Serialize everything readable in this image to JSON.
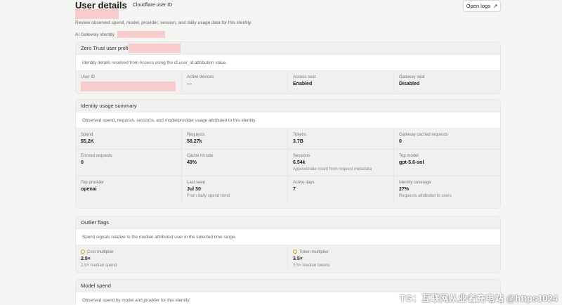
{
  "header": {
    "title": "User details",
    "uid_tag": "Cloudflare user ID",
    "open_logs": "Open logs",
    "open_logs_icon": "↗",
    "description": "Review observed spend, model, provider, session, and daily usage data for this identity.",
    "gateway_label": "AI Gateway identity"
  },
  "zero_trust": {
    "title": "Zero Trust user profi",
    "note": "Identity details resolved from Access using the cf.user_id attribution value.",
    "cells": [
      {
        "label": "User ID",
        "value": ""
      },
      {
        "label": "Active devices",
        "value": "—"
      },
      {
        "label": "Access seat",
        "value": "Enabled"
      },
      {
        "label": "Gateway seat",
        "value": "Disabled"
      }
    ]
  },
  "usage": {
    "title": "Identity usage summary",
    "note": "Observed spend, requests, sessions, and model/provider usage attributed to this identity.",
    "cells": [
      {
        "label": "Spend",
        "value": "$5.2K",
        "sub": ""
      },
      {
        "label": "Requests",
        "value": "58.27k",
        "sub": ""
      },
      {
        "label": "Tokens",
        "value": "3.7B",
        "sub": ""
      },
      {
        "label": "Gateway cached requests",
        "value": "0",
        "sub": ""
      },
      {
        "label": "Errored requests",
        "value": "0",
        "sub": ""
      },
      {
        "label": "Cache hit rate",
        "value": "49%",
        "sub": ""
      },
      {
        "label": "Sessions",
        "value": "6.54k",
        "sub": "Approximate count from request metadata"
      },
      {
        "label": "Top model",
        "value": "gpt-5.6-sol",
        "sub": ""
      },
      {
        "label": "Top provider",
        "value": "openai",
        "sub": ""
      },
      {
        "label": "Last seen",
        "value": "Jul 30",
        "sub": "From daily spend trend"
      },
      {
        "label": "Active days",
        "value": "7",
        "sub": ""
      },
      {
        "label": "Identity coverage",
        "value": "27%",
        "sub": "Requests attributed to users"
      }
    ]
  },
  "outlier": {
    "title": "Outlier flags",
    "note": "Spend signals relative to the median attributed user in the selected time range.",
    "cells": [
      {
        "label": "Cost multiplier",
        "value": "2.5×",
        "sub": "2.5× median spend"
      },
      {
        "label": "Token multiplier",
        "value": "3.5×",
        "sub": "3.5× median tokens"
      }
    ]
  },
  "model_spend": {
    "title": "Model spend",
    "note": "Observed spend by model and provider for this identity."
  },
  "watermark": "TG：互联网从业者充电站 @https1024"
}
